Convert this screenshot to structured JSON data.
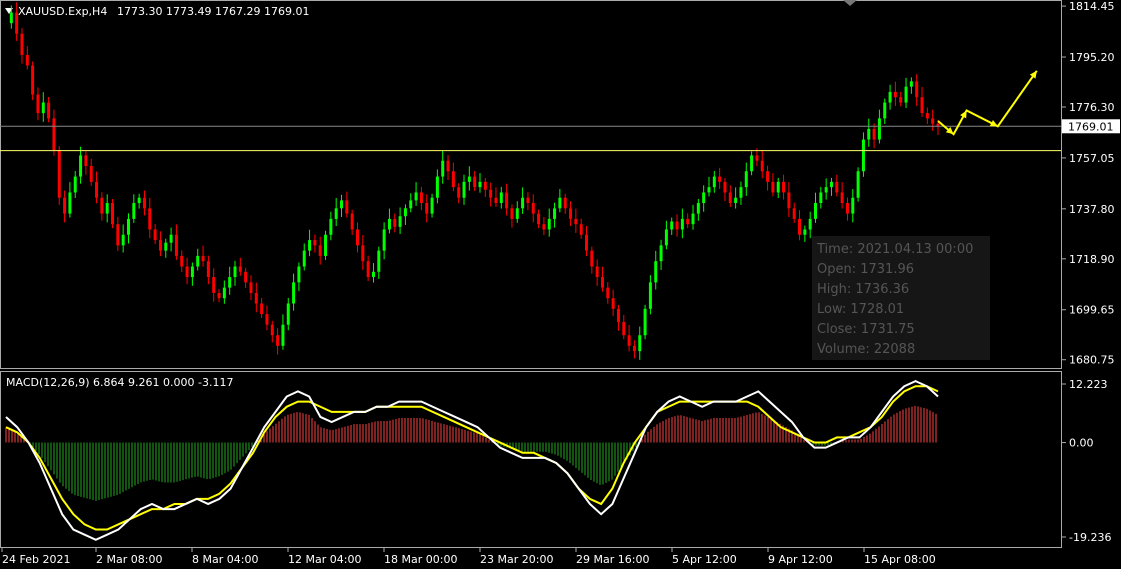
{
  "chart_data": [
    {
      "type": "candlestick",
      "title": "XAUUSD.Exp,H4",
      "ohlc_text": "1773.30 1773.49 1767.29 1769.01",
      "price_ticks": [
        "1814.45",
        "1795.20",
        "1776.30",
        "1769.01",
        "1757.05",
        "1737.80",
        "1718.90",
        "1699.65",
        "1680.75"
      ],
      "current_price": "1769.01",
      "ylim": [
        1678.0,
        1816.0
      ],
      "support_level": 1759.8,
      "candles_close_series": [
        1808,
        1812,
        1804,
        1796,
        1792,
        1781,
        1774,
        1778,
        1772,
        1760,
        1742,
        1736,
        1744,
        1750,
        1758,
        1754,
        1748,
        1742,
        1736,
        1740,
        1732,
        1724,
        1728,
        1734,
        1740,
        1742,
        1738,
        1730,
        1726,
        1722,
        1725,
        1728,
        1720,
        1716,
        1712,
        1716,
        1720,
        1718,
        1712,
        1706,
        1704,
        1708,
        1712,
        1716,
        1714,
        1710,
        1706,
        1702,
        1698,
        1694,
        1690,
        1686,
        1694,
        1702,
        1710,
        1716,
        1722,
        1726,
        1724,
        1720,
        1728,
        1734,
        1738,
        1741,
        1736,
        1730,
        1724,
        1718,
        1712,
        1714,
        1722,
        1730,
        1734,
        1731,
        1735,
        1738,
        1741,
        1744,
        1740,
        1736,
        1742,
        1750,
        1756,
        1752,
        1746,
        1742,
        1748,
        1750,
        1746,
        1748,
        1745,
        1742,
        1740,
        1744,
        1738,
        1734,
        1738,
        1742,
        1740,
        1736,
        1732,
        1730,
        1734,
        1738,
        1742,
        1738,
        1734,
        1732,
        1728,
        1722,
        1716,
        1712,
        1708,
        1704,
        1700,
        1695,
        1690,
        1686,
        1684,
        1690,
        1700,
        1710,
        1718,
        1724,
        1730,
        1733,
        1730,
        1734,
        1732,
        1736,
        1740,
        1744,
        1746,
        1750,
        1748,
        1744,
        1740,
        1742,
        1746,
        1752,
        1758,
        1756,
        1752,
        1748,
        1744,
        1748,
        1744,
        1738,
        1734,
        1728,
        1730,
        1734,
        1740,
        1744,
        1746,
        1748,
        1744,
        1740,
        1736,
        1742,
        1752,
        1764,
        1768,
        1764,
        1772,
        1778,
        1782,
        1780,
        1778,
        1784,
        1786,
        1780,
        1774,
        1772,
        1770,
        1769
      ],
      "forecast_arrows_path": [
        [
          0,
          1771
        ],
        [
          6,
          1766
        ],
        [
          11,
          1775
        ],
        [
          23,
          1769
        ],
        [
          38,
          1790
        ]
      ],
      "tooltip": {
        "time": "Time: 2021.04.13 00:00",
        "open": "Open: 1731.96",
        "high": "High: 1736.36",
        "low": "Low: 1728.01",
        "close": "Close: 1731.75",
        "volume": "Volume: 22088"
      }
    },
    {
      "type": "macd",
      "title": "MACD(12,26,9) 6.864 9.261 0.000 -3.117",
      "ticks": [
        "12.223",
        "0.00",
        "-19.236"
      ],
      "ylim": [
        -19.236,
        12.223
      ],
      "macd_line": [
        5,
        3,
        0,
        -4,
        -9,
        -14,
        -17,
        -18,
        -19,
        -18,
        -17,
        -15,
        -13,
        -12,
        -13,
        -13,
        -12,
        -11,
        -12,
        -11,
        -9,
        -5,
        -1,
        3,
        6,
        9,
        10,
        9,
        5,
        4,
        5,
        6,
        6,
        7,
        7,
        8,
        8,
        8,
        7,
        6,
        5,
        4,
        3,
        1,
        -1,
        -2,
        -3,
        -3,
        -3,
        -4,
        -6,
        -9,
        -12,
        -14,
        -12,
        -7,
        -2,
        3,
        6,
        8,
        9,
        8,
        7,
        8,
        8,
        8,
        9,
        10,
        8,
        6,
        4,
        1,
        -1,
        -1,
        0,
        1,
        1,
        3,
        6,
        9,
        11,
        12,
        11,
        9
      ],
      "signal_line": [
        3,
        2,
        0,
        -3,
        -7,
        -11,
        -14,
        -16,
        -17,
        -17,
        -16,
        -15,
        -14,
        -13,
        -13,
        -12,
        -12,
        -11,
        -11,
        -10,
        -8,
        -5,
        -2,
        2,
        5,
        7,
        8,
        8,
        7,
        6,
        6,
        6,
        6,
        7,
        7,
        7,
        7,
        7,
        6,
        5,
        4,
        3,
        2,
        1,
        0,
        -1,
        -2,
        -2,
        -3,
        -4,
        -6,
        -9,
        -11,
        -12,
        -9,
        -4,
        0,
        3,
        6,
        7,
        8,
        8,
        8,
        8,
        8,
        8,
        8,
        7,
        5,
        3,
        2,
        1,
        0,
        0,
        1,
        1,
        2,
        3,
        5,
        8,
        10,
        11,
        11,
        10
      ]
    }
  ],
  "time_axis": [
    "24 Feb 2021",
    "2 Mar 08:00",
    "8 Mar 04:00",
    "12 Mar 04:00",
    "18 Mar 00:00",
    "23 Mar 20:00",
    "29 Mar 16:00",
    "5 Apr 12:00",
    "9 Apr 12:00",
    "15 Apr 08:00"
  ],
  "colors": {
    "bull": "#00ff00",
    "bear": "#ff0000",
    "grid": "#888888",
    "support": "#ffff66",
    "arrows": "#ffff00",
    "macd_line": "#ffffff",
    "signal_line": "#ffff00",
    "hist_pos": "#ff4444",
    "hist_neg": "#22aa22"
  },
  "icons": {
    "menu": "triangle-down-icon",
    "scroll": "triangle-up-icon"
  }
}
